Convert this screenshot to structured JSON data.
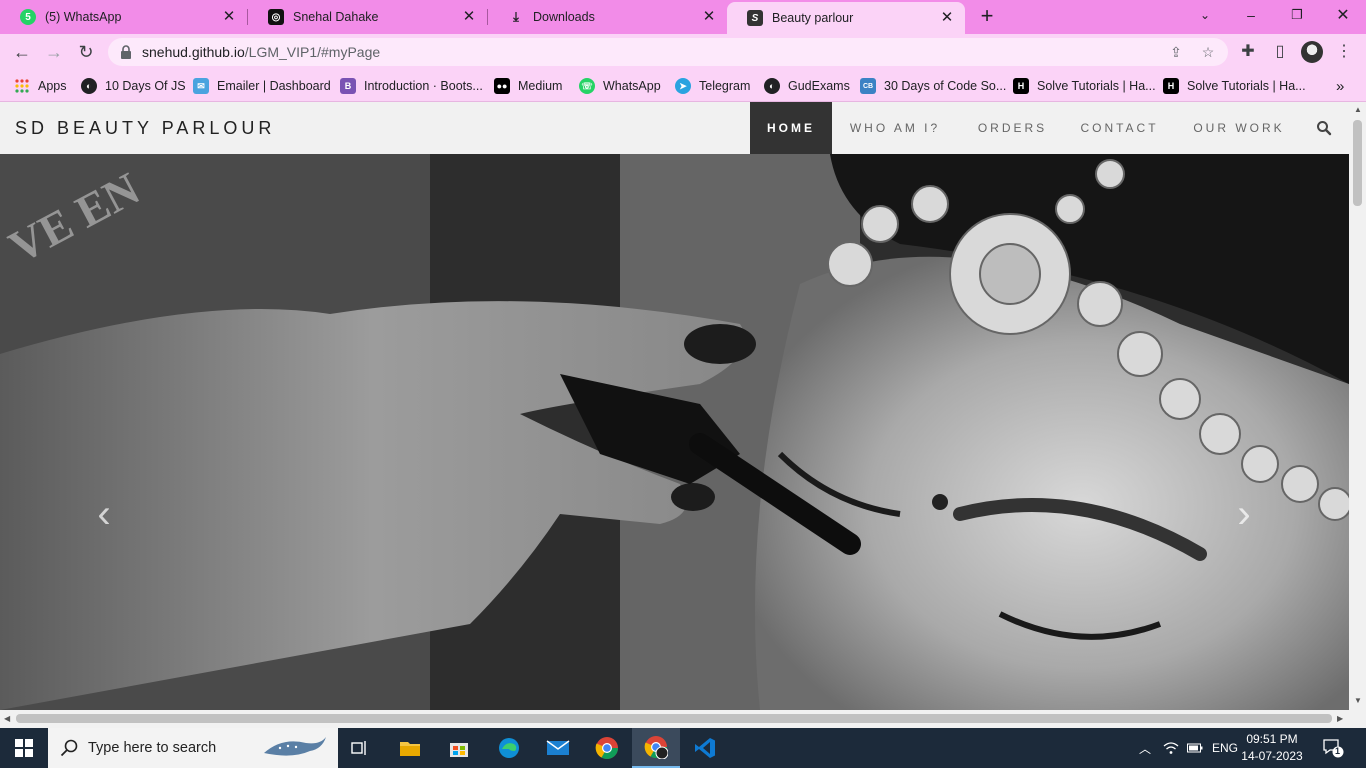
{
  "browser": {
    "tabs": [
      {
        "title": "(5) WhatsApp",
        "favicon": "whatsapp-icon",
        "badge": "5"
      },
      {
        "title": "Snehal Dahake",
        "favicon": "profile-site-icon"
      },
      {
        "title": "Downloads",
        "favicon": "download-icon"
      },
      {
        "title": "Beauty parlour",
        "favicon": "s-site-icon",
        "active": true
      }
    ],
    "url": {
      "host": "snehud.github.io",
      "path": "/LGM_VIP1/#myPage"
    },
    "bookmarks": [
      {
        "label": "Apps",
        "icon": "apps-grid-icon"
      },
      {
        "label": "10 Days Of JS",
        "icon": "globe-icon"
      },
      {
        "label": "Emailer | Dashboard",
        "icon": "emailer-icon"
      },
      {
        "label": "Introduction · Boots...",
        "icon": "bootstrap-icon",
        "glyph": "B"
      },
      {
        "label": "Medium",
        "icon": "medium-icon"
      },
      {
        "label": "WhatsApp",
        "icon": "whatsapp-icon"
      },
      {
        "label": "Telegram",
        "icon": "telegram-icon"
      },
      {
        "label": "GudExams",
        "icon": "globe-icon"
      },
      {
        "label": "30 Days of Code So...",
        "icon": "codebeautify-icon",
        "glyph": "CB"
      },
      {
        "label": "Solve Tutorials | Ha...",
        "icon": "hackerrank-icon",
        "glyph": "H"
      },
      {
        "label": "Solve Tutorials | Ha...",
        "icon": "hackerrank-icon",
        "glyph": "H"
      }
    ],
    "colors": {
      "tabstrip": "#f28ce8",
      "toolbar": "#fbd3f7"
    }
  },
  "site": {
    "brand": "SD BEAUTY PARLOUR",
    "nav": [
      {
        "label": "HOME",
        "active": true
      },
      {
        "label": "WHO AM I?"
      },
      {
        "label": "ORDERS"
      },
      {
        "label": "CONTACT"
      },
      {
        "label": "OUR WORK"
      }
    ],
    "hero": {
      "image": "black-and-white bridal makeup photo, mascara being applied",
      "prev_glyph": "‹",
      "next_glyph": "›"
    }
  },
  "taskbar": {
    "search_placeholder": "Type here to search",
    "apps": [
      "task-view-icon",
      "file-explorer-icon",
      "store-icon",
      "edge-icon",
      "mail-icon",
      "chrome-icon",
      "chrome-profile-icon",
      "vscode-icon"
    ],
    "tray": {
      "language": "ENG",
      "time": "09:51 PM",
      "date": "14-07-2023",
      "notifications": "1"
    }
  }
}
